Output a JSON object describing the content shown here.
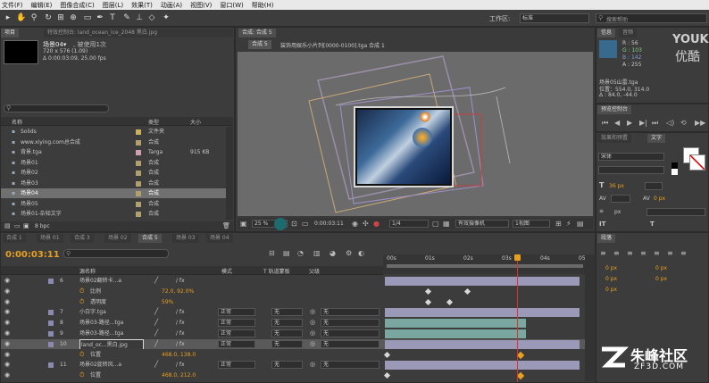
{
  "menu": [
    "文件(F)",
    "编辑(E)",
    "图像合成(C)",
    "图层(L)",
    "效果(T)",
    "动画(A)",
    "视图(V)",
    "窗口(W)",
    "帮助(H)"
  ],
  "workspace": {
    "label": "工作区:",
    "value": "标准"
  },
  "search": {
    "placeholder": "搜索帮助"
  },
  "project": {
    "tab": "项目",
    "effects_tab": "特效控制台: land_ocean_ice_2048 黑白.jpg",
    "item_name": "场景04▾",
    "item_used": ", 被使用1次",
    "item_dims": "720 x 576 (1.09)",
    "item_duration": "Δ 0:00:03:09, 25.00 fps",
    "col_name": "名称",
    "col_type": "类型",
    "col_size": "大小",
    "bpc": "8 bpc",
    "rows": [
      {
        "name": "Solids",
        "type": "文件夹",
        "size": "",
        "color": "#c8b060"
      },
      {
        "name": "www.xiying.com总合成",
        "type": "合成",
        "size": "",
        "color": "#b0a070"
      },
      {
        "name": "背景.tga",
        "type": "Targa",
        "size": "915 KB",
        "color": "#d0a0b0"
      },
      {
        "name": "场景01",
        "type": "合成",
        "size": "",
        "color": "#b0a070"
      },
      {
        "name": "场景02",
        "type": "合成",
        "size": "",
        "color": "#b0a070"
      },
      {
        "name": "场景03",
        "type": "合成",
        "size": "",
        "color": "#b0a070"
      },
      {
        "name": "场景04",
        "type": "合成",
        "size": "",
        "color": "#b0a070"
      },
      {
        "name": "场景05",
        "type": "合成",
        "size": "",
        "color": "#b0a070"
      },
      {
        "name": "场景01-杂知文字",
        "type": "合成",
        "size": "",
        "color": "#b0a070"
      }
    ]
  },
  "comp": {
    "tab": "合成: 合成 5",
    "sub_tab": "合成 5",
    "breadcrumb": "装饰用娱乐小片列[0000-0100].tga 合成 1",
    "zoom": "25 %",
    "time": "0:00:03:11",
    "res": "1/4",
    "camera": "有效摄像机",
    "views": "1视图"
  },
  "info": {
    "tab": "信息",
    "audio_tab": "音频",
    "r": "R : 56",
    "g": "G : 103",
    "b": "B : 142",
    "a": "A : 255",
    "x": "X : 524",
    "y": "Y : 382",
    "file": "场景05山雷.tga",
    "pos": "位置：554.0, 314.0",
    "delta": "Δ : 84.0, -44.0"
  },
  "preview": {
    "tab": "预览控制台"
  },
  "char": {
    "tab1": "效果和预置",
    "tab2": "文字",
    "font": "宋体",
    "size": "36 px",
    "tracking": "0 px",
    "leading_px": "0 px",
    "px_label": "px"
  },
  "para": {
    "tab": "段落",
    "a": "0 px",
    "b": "0 px",
    "c": "0 px",
    "d": "0 px",
    "e": "0 px"
  },
  "timeline": {
    "tabs": [
      "合成 1",
      "场景 01",
      "合成 3",
      "场景 02",
      "合成 5",
      "场景 03",
      "场景 04"
    ],
    "active": 4,
    "time": "0:00:03:11",
    "col_name": "源名称",
    "col_mode": "模式",
    "col_trk": "T 轨道蒙板",
    "col_parent": "父级",
    "ruler": [
      "00s",
      "01s",
      "02s",
      "03s",
      "04s",
      "05s"
    ],
    "layers": [
      {
        "num": "6",
        "name": "场景02翻转卡...a",
        "mode": "",
        "trk": "",
        "parent": "",
        "bar": "#9a9ab8",
        "val": "",
        "twirl": true
      },
      {
        "num": "",
        "name": "比例",
        "mode": "",
        "trk": "",
        "parent": "",
        "bar": "",
        "val": "72.0, 92.0%",
        "prop": true
      },
      {
        "num": "",
        "name": "透明度",
        "mode": "",
        "trk": "",
        "parent": "",
        "bar": "",
        "val": "59%",
        "prop": true
      },
      {
        "num": "7",
        "name": "小白字.tga",
        "mode": "正常",
        "trk": "无",
        "parent": "无",
        "bar": "#9a9ab8",
        "val": ""
      },
      {
        "num": "8",
        "name": "场景03-路径...tga",
        "mode": "正常",
        "trk": "无",
        "parent": "无",
        "bar": "#7aa8a0",
        "val": ""
      },
      {
        "num": "9",
        "name": "场景03-路径...tga",
        "mode": "正常",
        "trk": "无",
        "parent": "无",
        "bar": "#7aa8a0",
        "val": ""
      },
      {
        "num": "10",
        "name": "land_oc...黑白.jpg",
        "mode": "正常",
        "trk": "无",
        "parent": "无",
        "bar": "#9a9ab8",
        "val": "",
        "selected": true
      },
      {
        "num": "",
        "name": "位置",
        "mode": "",
        "trk": "",
        "parent": "",
        "bar": "",
        "val": "468.0, 138.0",
        "prop": true
      },
      {
        "num": "11",
        "name": "场景02旋转风...a",
        "mode": "正常",
        "trk": "无",
        "parent": "无",
        "bar": "#9a9ab8",
        "val": ""
      },
      {
        "num": "",
        "name": "位置",
        "mode": "",
        "trk": "",
        "parent": "",
        "bar": "",
        "val": "468.0, 212.0",
        "prop": true
      }
    ]
  },
  "watermark": {
    "youku": "YOUKU",
    "youku_cn": "优酷",
    "site": "朱峰社区",
    "site_url": "ZF3D.COM"
  }
}
